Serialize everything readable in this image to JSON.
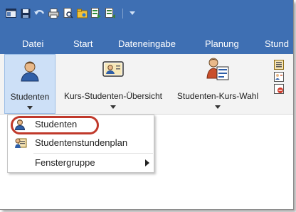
{
  "quick_access": {
    "icons": [
      "window-icon",
      "save-icon",
      "undo-icon",
      "print-icon",
      "print-preview-icon",
      "open-folder-icon",
      "export-icon",
      "import-icon",
      "customize-dropdown-icon"
    ]
  },
  "tabs": [
    "Datei",
    "Start",
    "Dateneingabe",
    "Planung",
    "Stund"
  ],
  "ribbon": {
    "buttons": [
      {
        "label": "Studenten",
        "icon": "student-icon"
      },
      {
        "label": "Kurs-Studenten-Übersicht",
        "icon": "course-student-overview-icon"
      },
      {
        "label": "Studenten-Kurs-Wahl",
        "icon": "student-course-choice-icon"
      }
    ],
    "small_icons": [
      "list-icon",
      "student-list-icon",
      "remove-icon"
    ]
  },
  "menu": {
    "items": [
      {
        "label": "Studenten",
        "icon": "student-icon"
      },
      {
        "label": "Studentenstundenplan",
        "icon": "student-timetable-icon"
      },
      {
        "label": "Fenstergruppe",
        "icon": "",
        "has_submenu": true
      }
    ]
  },
  "colors": {
    "title_bar": "#3e6fb3",
    "ribbon_bg": "#f3f3f3",
    "selected_button": "#cde0f7",
    "highlight_ring": "#c0392b"
  }
}
